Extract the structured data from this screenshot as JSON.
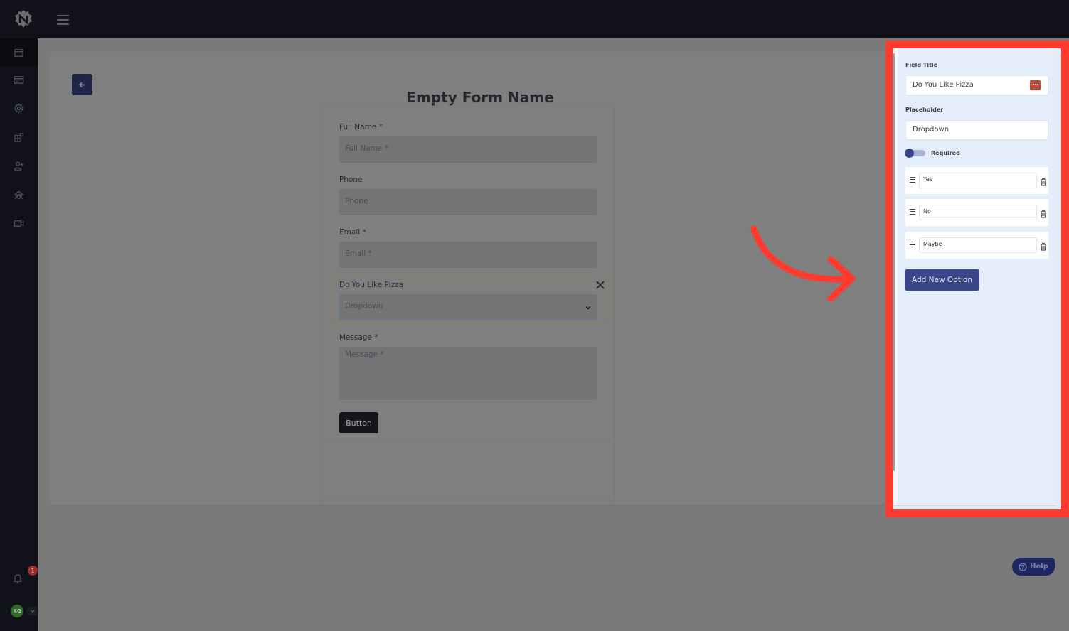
{
  "topbar": {
    "logo_icon": "gear-n-logo-icon",
    "menu_icon": "hamburger-menu-icon"
  },
  "sidebar": {
    "items": [
      {
        "icon": "browser-window-icon",
        "active": true
      },
      {
        "icon": "card-icon",
        "active": false
      },
      {
        "icon": "gear-icon",
        "active": false
      },
      {
        "icon": "widgets-icon",
        "active": false
      },
      {
        "icon": "add-user-icon",
        "active": false
      },
      {
        "icon": "team-icon",
        "active": false
      },
      {
        "icon": "video-camera-icon",
        "active": false
      }
    ],
    "notification_count": "1",
    "avatar_initials": "KG"
  },
  "page": {
    "back_icon": "arrow-left-icon",
    "form_title": "Empty Form Name"
  },
  "form": {
    "fields": [
      {
        "label": "Full Name *",
        "placeholder": "Full Name *",
        "type": "text"
      },
      {
        "label": "Phone",
        "placeholder": "Phone",
        "type": "text"
      },
      {
        "label": "Email *",
        "placeholder": "Email *",
        "type": "text"
      },
      {
        "label": "Do You Like Pizza",
        "placeholder": "Dropdown",
        "type": "select",
        "selected": true
      },
      {
        "label": "Message *",
        "placeholder": "Message *",
        "type": "textarea"
      }
    ],
    "submit_label": "Button"
  },
  "settings_panel": {
    "field_title_label": "Field Title",
    "field_title_value": "Do You Like Pizza",
    "placeholder_label": "Placeholder",
    "placeholder_value": "Dropdown",
    "required_label": "Required",
    "required": false,
    "options": [
      "Yes",
      "No",
      "Maybe"
    ],
    "add_option_label": "Add New Option"
  },
  "annotation": {
    "highlight_color": "#ff3b2f",
    "arrow_color": "#ff3b2f"
  },
  "help": {
    "label": "Help"
  },
  "colors": {
    "primary": "#3a468a",
    "topbar": "#111219",
    "accent_red": "#c0493a"
  }
}
